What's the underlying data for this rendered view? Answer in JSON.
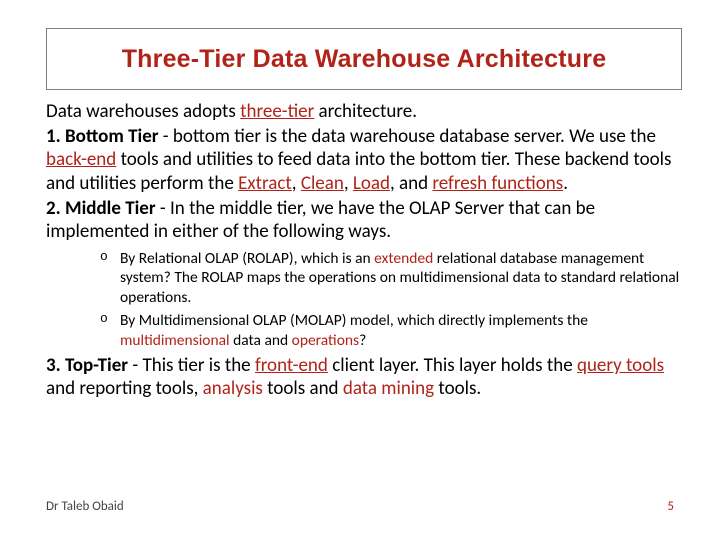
{
  "title": "Three-Tier Data Warehouse Architecture",
  "intro": {
    "prefix": "Data warehouses adopts ",
    "link": "three-tier",
    "suffix": " architecture."
  },
  "tier1": {
    "label": "1. Bottom Tier",
    "span1": " - bottom tier is the data warehouse database server. We use the ",
    "kw1": "back-end",
    "span2": " tools and utilities to feed data into the bottom tier. These backend tools and utilities perform the ",
    "kw2": "Extract",
    "c1": ", ",
    "kw3": "Clean",
    "c2": ", ",
    "kw4": "Load",
    "c3": ", and ",
    "kw5": "refresh functions",
    "end": "."
  },
  "tier2": {
    "label": "2. Middle Tier",
    "body": " - In the middle tier, we have the OLAP Server that can be implemented in either of the following ways.",
    "bullets": {
      "b1": {
        "p1": "By Relational OLAP (ROLAP), which is an ",
        "kw": "extended",
        "p2": " relational database management system? The ROLAP maps the operations on multidimensional data to standard relational operations."
      },
      "b2": {
        "p1": "By Multidimensional OLAP (MOLAP) model, which directly implements the ",
        "kw1": "multidimensional",
        "p2": " data and ",
        "kw2": "operations",
        "p3": "?"
      }
    }
  },
  "tier3": {
    "label": "3. Top-Tier",
    "p1": " - This tier is the ",
    "kw1": "front-end",
    "p2": " client layer. This layer holds the ",
    "kw2": "query tools",
    "p3": " and reporting tools, ",
    "kw3": "analysis",
    "p4": " tools and ",
    "kw4": "data mining",
    "p5": " tools."
  },
  "footer": {
    "author": "Dr Taleb Obaid",
    "page": "5"
  }
}
